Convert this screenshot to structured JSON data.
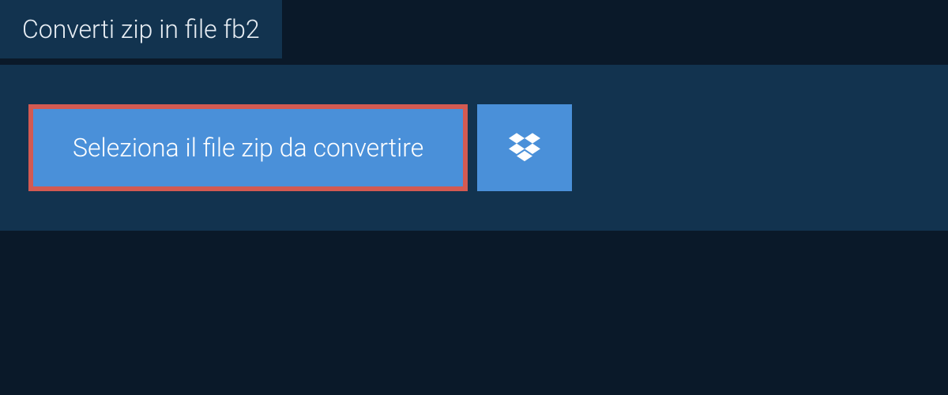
{
  "tab": {
    "title": "Converti zip in file fb2"
  },
  "actions": {
    "select_file_label": "Seleziona il file zip da convertire"
  },
  "colors": {
    "background": "#0a1929",
    "panel": "#12334f",
    "button": "#4a90d9",
    "highlight_border": "#d35a52",
    "text": "#ffffff"
  }
}
